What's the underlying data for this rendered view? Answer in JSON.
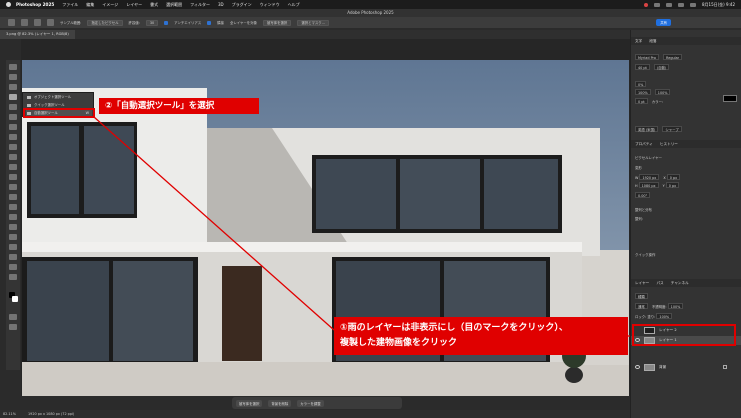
{
  "menubar": {
    "app_name": "Photoshop 2025",
    "items": [
      "ファイル",
      "編集",
      "イメージ",
      "レイヤー",
      "書式",
      "選択範囲",
      "フィルター",
      "3D",
      "プラグイン",
      "ウィンドウ",
      "ヘルプ"
    ],
    "clock": "8月15日(金) 9:42"
  },
  "window": {
    "title": "Adobe Photoshop 2025"
  },
  "options_bar": {
    "sample_label": "サンプル範囲:",
    "sample_value": "指定したピクセル",
    "tolerance_label": "許容値:",
    "tolerance_value": "30",
    "antialias_label": "アンチエイリアス",
    "contiguous_label": "隣接",
    "all_layers_label": "全レイヤーを対象",
    "subject_button": "被写体を選択",
    "mask_button": "選択とマスク...",
    "share_button": "共有"
  },
  "document": {
    "tab_label": "3.png @ 82.3% (レイヤー 1, RGB/8)"
  },
  "flyout": {
    "items": [
      "オブジェクト選択ツール",
      "クイック選択ツール",
      "自動選択ツール"
    ],
    "shortcut": "W"
  },
  "annotations": {
    "step2": "②「自動選択ツール」を選択",
    "step1_line1": "①雨のレイヤーは非表示にし（目のマークをクリック）、",
    "step1_line2": "複製した建物画像をクリック"
  },
  "taskbar": {
    "items": [
      "被写体を選択",
      "背景を削除",
      "カラーを調整"
    ]
  },
  "status": {
    "zoom": "82.11%",
    "size": "1920 px x 1080 px (72 ppi)"
  },
  "character_panel": {
    "tabs": [
      "文字",
      "段落"
    ],
    "font": "Myriad Pro",
    "style": "Regular",
    "size": "40 pt",
    "leading": "(自動)",
    "tracking": "0%",
    "scale_v": "100%",
    "scale_h": "100%",
    "baseline": "0 pt",
    "color_label": "カラー:",
    "lang": "英語 (米国)",
    "aa": "シャープ"
  },
  "properties_panel": {
    "tabs": [
      "プロパティ",
      "ヒストリー"
    ],
    "layer_type": "ピクセルレイヤー",
    "transform_label": "変形",
    "w_label": "W",
    "w_value": "1920 px",
    "h_label": "H",
    "h_value": "1080 px",
    "x_label": "X",
    "x_value": "0 px",
    "y_label": "Y",
    "y_value": "0 px",
    "angle": "0.00°",
    "align_label": "整列と分布",
    "align_sub": "整列:",
    "quick_actions": "クイック操作"
  },
  "layers_panel": {
    "tabs": [
      "レイヤー",
      "パス",
      "チャンネル"
    ],
    "search": "種類",
    "blend": "通常",
    "opacity_label": "不透明度:",
    "opacity_value": "100%",
    "lock_label": "ロック:",
    "fill_label": "塗り:",
    "fill_value": "100%",
    "layers": [
      {
        "name": "レイヤー 2",
        "visible": false,
        "selected": false,
        "thumb": "dark"
      },
      {
        "name": "レイヤー 1",
        "visible": true,
        "selected": true,
        "thumb": "building"
      },
      {
        "name": "背景",
        "visible": true,
        "selected": false,
        "thumb": "building",
        "locked": true
      }
    ]
  },
  "colors": {
    "annotation_red": "#e00000",
    "accent_blue": "#1f6fe0"
  }
}
